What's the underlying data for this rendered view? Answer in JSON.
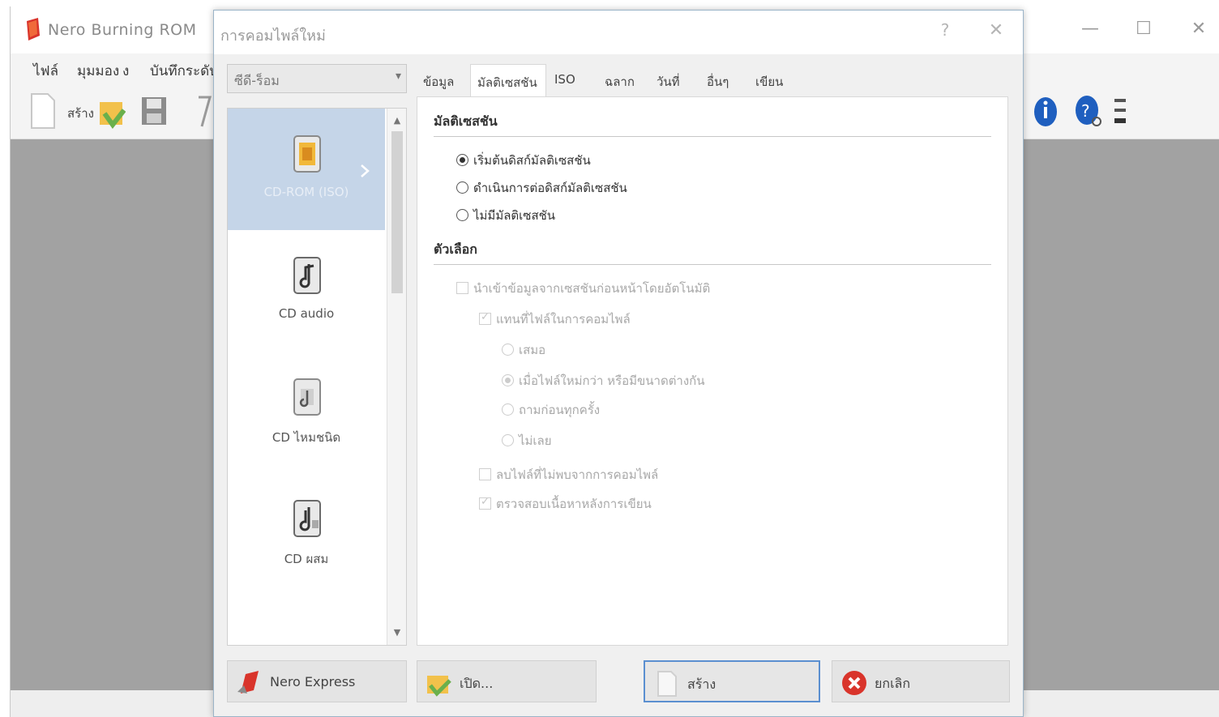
{
  "main_window": {
    "title": "Nero Burning ROM",
    "menus": [
      "ไฟล์",
      "มุมมอง",
      "ง",
      "บันทึกระดับ"
    ],
    "toolbar_new_label": "สร้าง",
    "controls": {
      "minimize": "—",
      "maximize": "☐",
      "close": "✕"
    }
  },
  "dialog": {
    "title": "การคอมไพล์ใหม่",
    "help": "?",
    "close": "✕",
    "disc_type": "ซีดี-ร็อม",
    "projects": [
      {
        "label": "CD-ROM (ISO)",
        "selected": true
      },
      {
        "label": "CD audio",
        "selected": false
      },
      {
        "label": "CD ไหมชนิด",
        "selected": false
      },
      {
        "label": "CD ผสม",
        "selected": false
      }
    ],
    "scroll": {
      "up": "▲",
      "down": "▼"
    },
    "tabs": [
      {
        "label": "ข้อมูล",
        "active": false
      },
      {
        "label": "มัลติเซสชัน",
        "active": true
      },
      {
        "label": "ISO",
        "active": false
      },
      {
        "label": "ฉลาก",
        "active": false
      },
      {
        "label": "วันที่",
        "active": false
      },
      {
        "label": "อื่นๆ",
        "active": false
      },
      {
        "label": "เขียน",
        "active": false
      }
    ],
    "multisession": {
      "section_title": "มัลติเซสชัน",
      "options": [
        {
          "label": "เริ่มต้นดิสก์มัลติเซสชัน",
          "checked": true
        },
        {
          "label": "ดำเนินการต่อดิสก์มัลติเซสชัน",
          "checked": false
        },
        {
          "label": "ไม่มีมัลติเซสชัน",
          "checked": false
        }
      ]
    },
    "options_section": {
      "section_title": "ตัวเลือก",
      "items": [
        {
          "kind": "check",
          "label": "นำเข้าข้อมูลจากเซสชันก่อนหน้าโดยอัตโนมัติ",
          "checked": false
        },
        {
          "kind": "check",
          "label": "แทนที่ไฟล์ในการคอมไพล์",
          "checked": true
        },
        {
          "kind": "radio",
          "label": "เสมอ",
          "checked": false
        },
        {
          "kind": "radio",
          "label": "เมื่อไฟล์ใหม่กว่า หรือมีขนาดต่างกัน",
          "checked": true
        },
        {
          "kind": "radio",
          "label": "ถามก่อนทุกครั้ง",
          "checked": false
        },
        {
          "kind": "radio",
          "label": "ไม่เลย",
          "checked": false
        },
        {
          "kind": "check",
          "label": "ลบไฟล์ที่ไม่พบจากการคอมไพล์",
          "checked": false
        },
        {
          "kind": "check",
          "label": "ตรวจสอบเนื้อหาหลังการเขียน",
          "checked": true
        }
      ]
    },
    "buttons": {
      "express": "Nero Express",
      "open": "เปิด...",
      "new": "สร้าง",
      "cancel": "ยกเลิก"
    }
  },
  "colors": {
    "selection": "#c5d5e8",
    "default_button_border": "#5b8fd0",
    "workspace_gray": "#a2a2a2",
    "cancel_red": "#d9342b"
  }
}
